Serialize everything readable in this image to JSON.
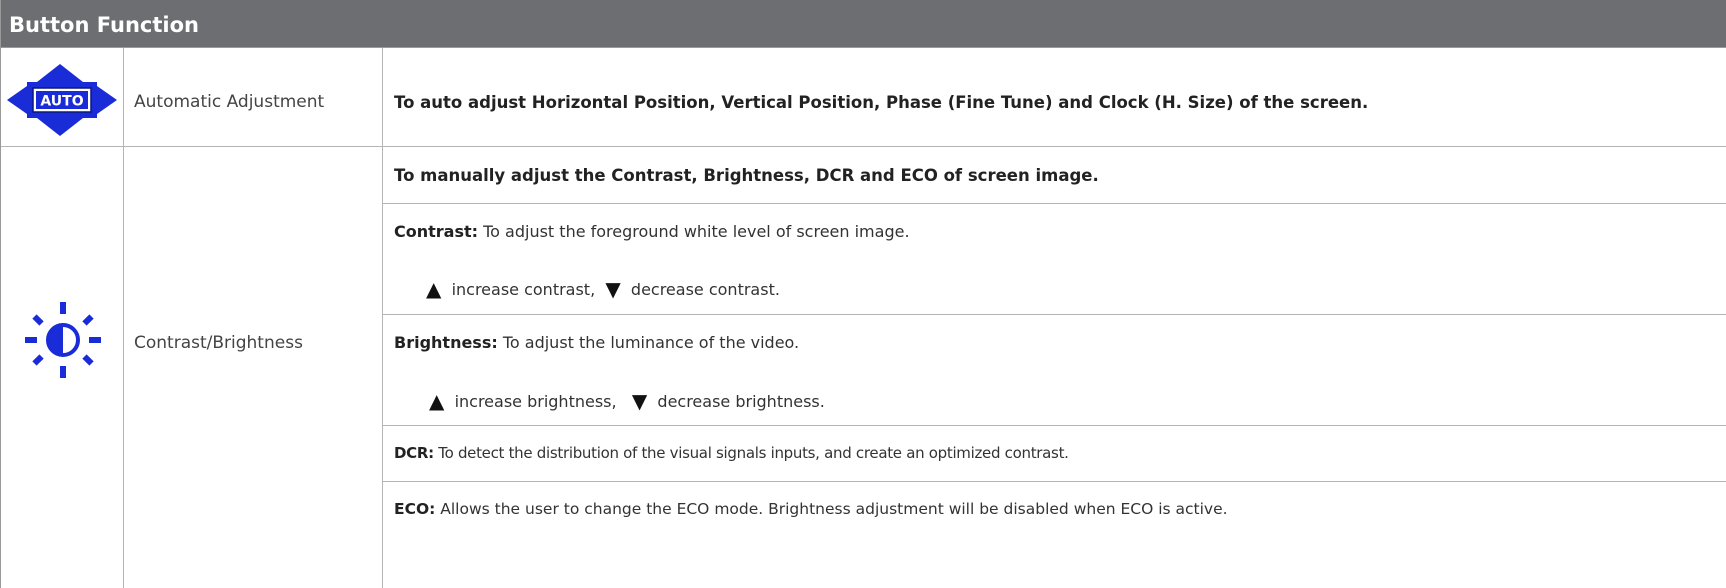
{
  "header": {
    "title": "Button Function"
  },
  "rows": [
    {
      "icon": "auto-adjust-icon",
      "name": "Automatic Adjustment",
      "description": "To auto adjust Horizontal Position, Vertical Position, Phase (Fine Tune) and Clock (H. Size) of the screen."
    },
    {
      "icon": "brightness-sun-icon",
      "name": "Contrast/Brightness",
      "intro": "To manually adjust the Contrast, Brightness, DCR and ECO of screen image.",
      "contrast": {
        "term": "Contrast:",
        "text": " To adjust the foreground white level of screen image.",
        "up_symbol": "▲",
        "up_text": "increase contrast,",
        "down_symbol": "▼",
        "down_text": "decrease contrast."
      },
      "brightness": {
        "term": "Brightness:",
        "text": " To adjust the luminance of the video.",
        "up_symbol": "▲",
        "up_text": "increase brightness,",
        "down_symbol": "▼",
        "down_text": "decrease brightness."
      },
      "dcr": {
        "term": "DCR:",
        "text": " To detect the distribution of the visual signals inputs, and create an optimized contrast."
      },
      "eco": {
        "term": "ECO:",
        "text": " Allows the user to change the ECO mode. Brightness adjustment will be disabled when ECO is active."
      }
    }
  ],
  "colors": {
    "header_bg": "#6d6e71",
    "icon_blue": "#1a2bd8",
    "grid": "#b5b5b5"
  }
}
